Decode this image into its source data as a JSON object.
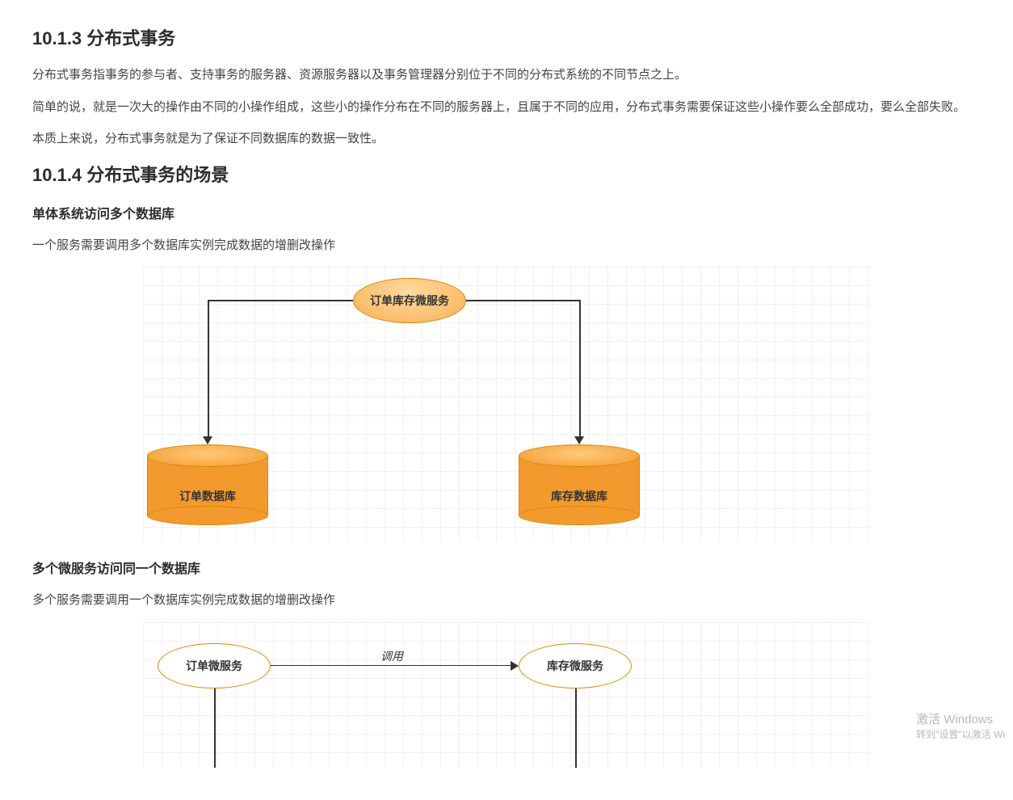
{
  "section1": {
    "heading": "10.1.3 分布式事务",
    "p1": "分布式事务指事务的参与者、支持事务的服务器、资源服务器以及事务管理器分别位于不同的分布式系统的不同节点之上。",
    "p2": "简单的说，就是一次大的操作由不同的小操作组成，这些小的操作分布在不同的服务器上，且属于不同的应用，分布式事务需要保证这些小操作要么全部成功，要么全部失败。",
    "p3": "本质上来说，分布式事务就是为了保证不同数据库的数据一致性。"
  },
  "section2": {
    "heading": "10.1.4 分布式事务的场景",
    "sub1_title": "单体系统访问多个数据库",
    "sub1_desc": "一个服务需要调用多个数据库实例完成数据的增删改操作",
    "sub2_title": "多个微服务访问同一个数据库",
    "sub2_desc": "多个服务需要调用一个数据库实例完成数据的增删改操作"
  },
  "diagram1": {
    "top_node": "订单库存微服务",
    "left_db": "订单数据库",
    "right_db": "库存数据库"
  },
  "diagram2": {
    "left_node": "订单微服务",
    "right_node": "库存微服务",
    "edge_label": "调用"
  },
  "watermark": {
    "line1": "激活 Windows",
    "line2": "转到\"设置\"以激活 Wi"
  }
}
